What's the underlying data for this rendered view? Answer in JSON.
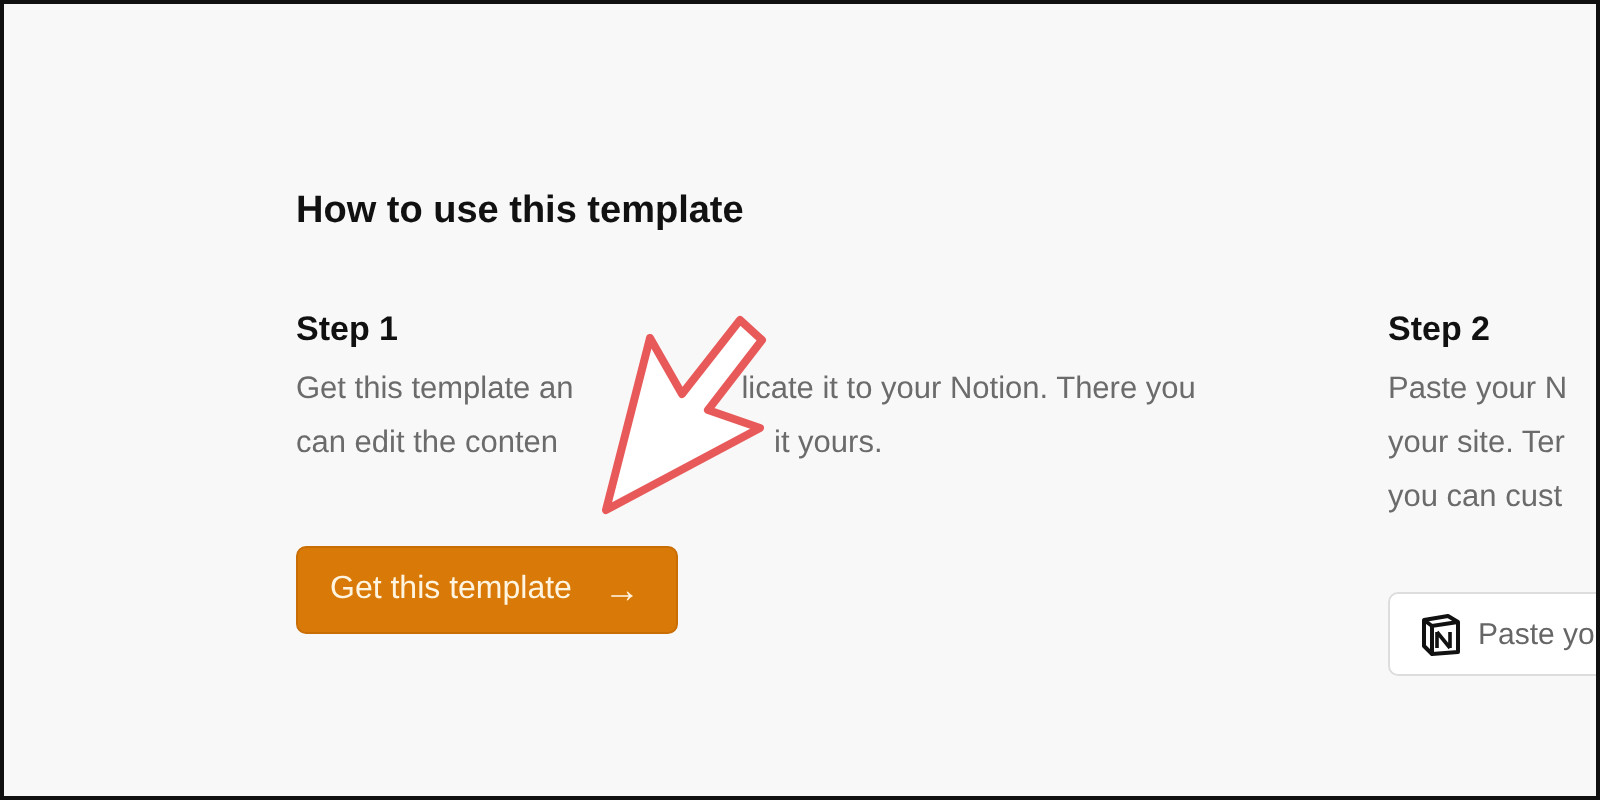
{
  "heading": "How to use this template",
  "steps": [
    {
      "title": "Step 1",
      "lines": [
        [
          "Get this template an",
          "licate it to your Notion. There you"
        ],
        [
          "can edit the conten",
          "it yours."
        ]
      ],
      "button": {
        "kind": "primary",
        "label": "Get this template",
        "icon": "→"
      }
    },
    {
      "title": "Step 2",
      "lines": [
        [
          "Paste your N"
        ],
        [
          "your site. Ter"
        ],
        [
          "you can cust"
        ]
      ],
      "button": {
        "kind": "notion",
        "label": "Paste yo"
      }
    }
  ]
}
